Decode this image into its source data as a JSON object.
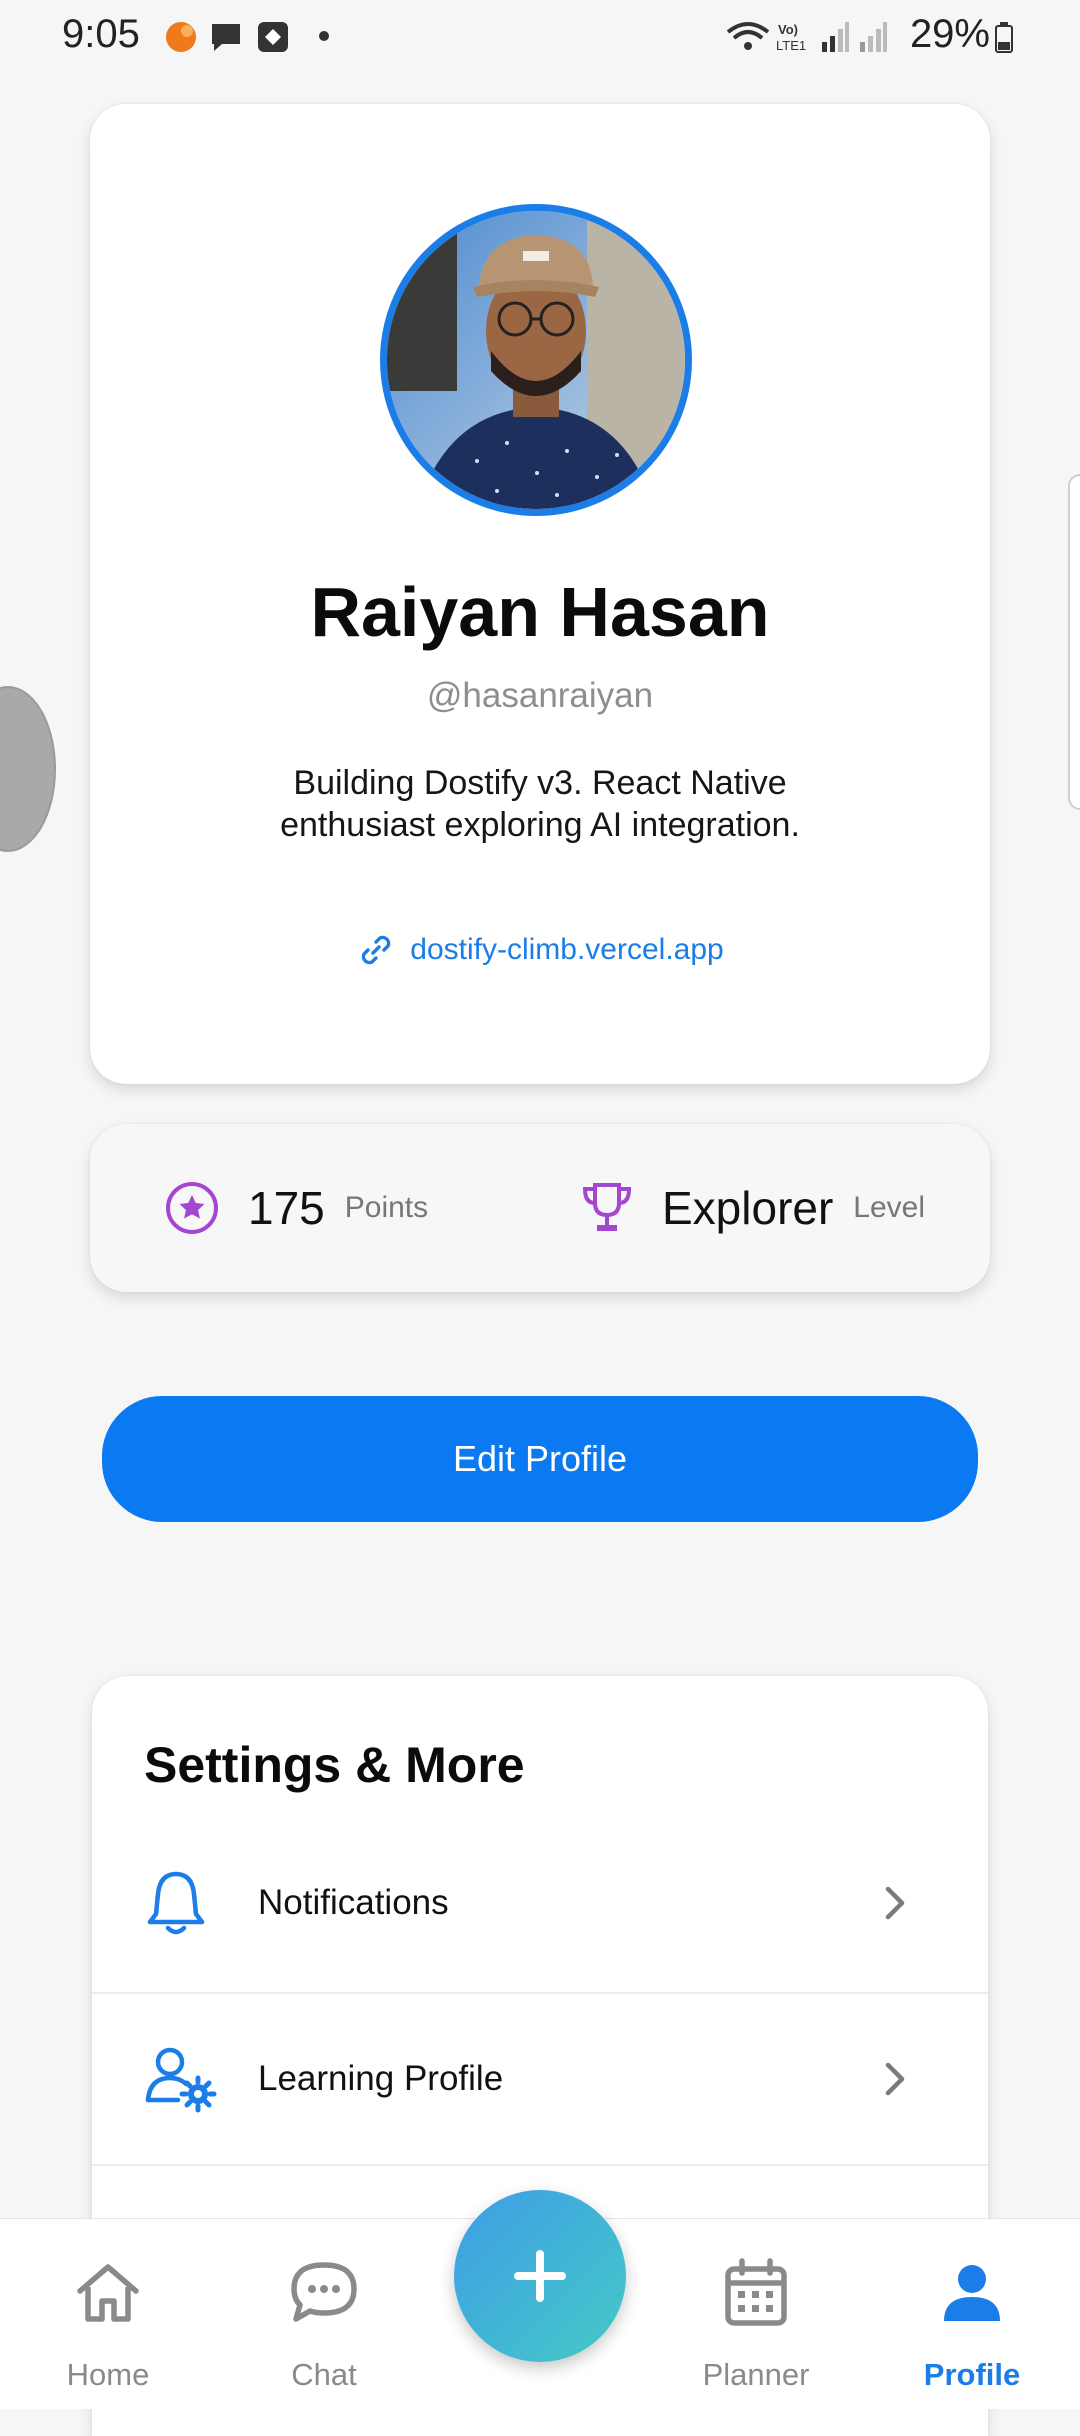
{
  "status_bar": {
    "time": "9:05",
    "battery": "29%"
  },
  "profile": {
    "name": "Raiyan Hasan",
    "handle": "@hasanraiyan",
    "bio_line1": "Building Dostify v3. React Native",
    "bio_line2": "enthusiast exploring AI integration.",
    "link": "dostify-climb.vercel.app"
  },
  "stats": {
    "points_value": "175",
    "points_label": "Points",
    "level_value": "Explorer",
    "level_label": "Level"
  },
  "edit_button": {
    "label": "Edit Profile"
  },
  "settings": {
    "title": "Settings & More",
    "items": [
      {
        "label": "Notifications",
        "icon": "bell-icon"
      },
      {
        "label": "Learning Profile",
        "icon": "user-gear-icon"
      }
    ]
  },
  "bottom_nav": {
    "items": [
      {
        "label": "Home",
        "icon": "home-icon"
      },
      {
        "label": "Chat",
        "icon": "chat-bubble-icon"
      },
      {
        "label": "Planner",
        "icon": "calendar-icon"
      },
      {
        "label": "Profile",
        "icon": "person-icon",
        "active": true
      }
    ],
    "fab_icon": "plus-icon"
  },
  "colors": {
    "accent": "#0a79f2",
    "link": "#1a7de8",
    "stat_icon": "#a347d1",
    "background": "#f6f6f6"
  }
}
